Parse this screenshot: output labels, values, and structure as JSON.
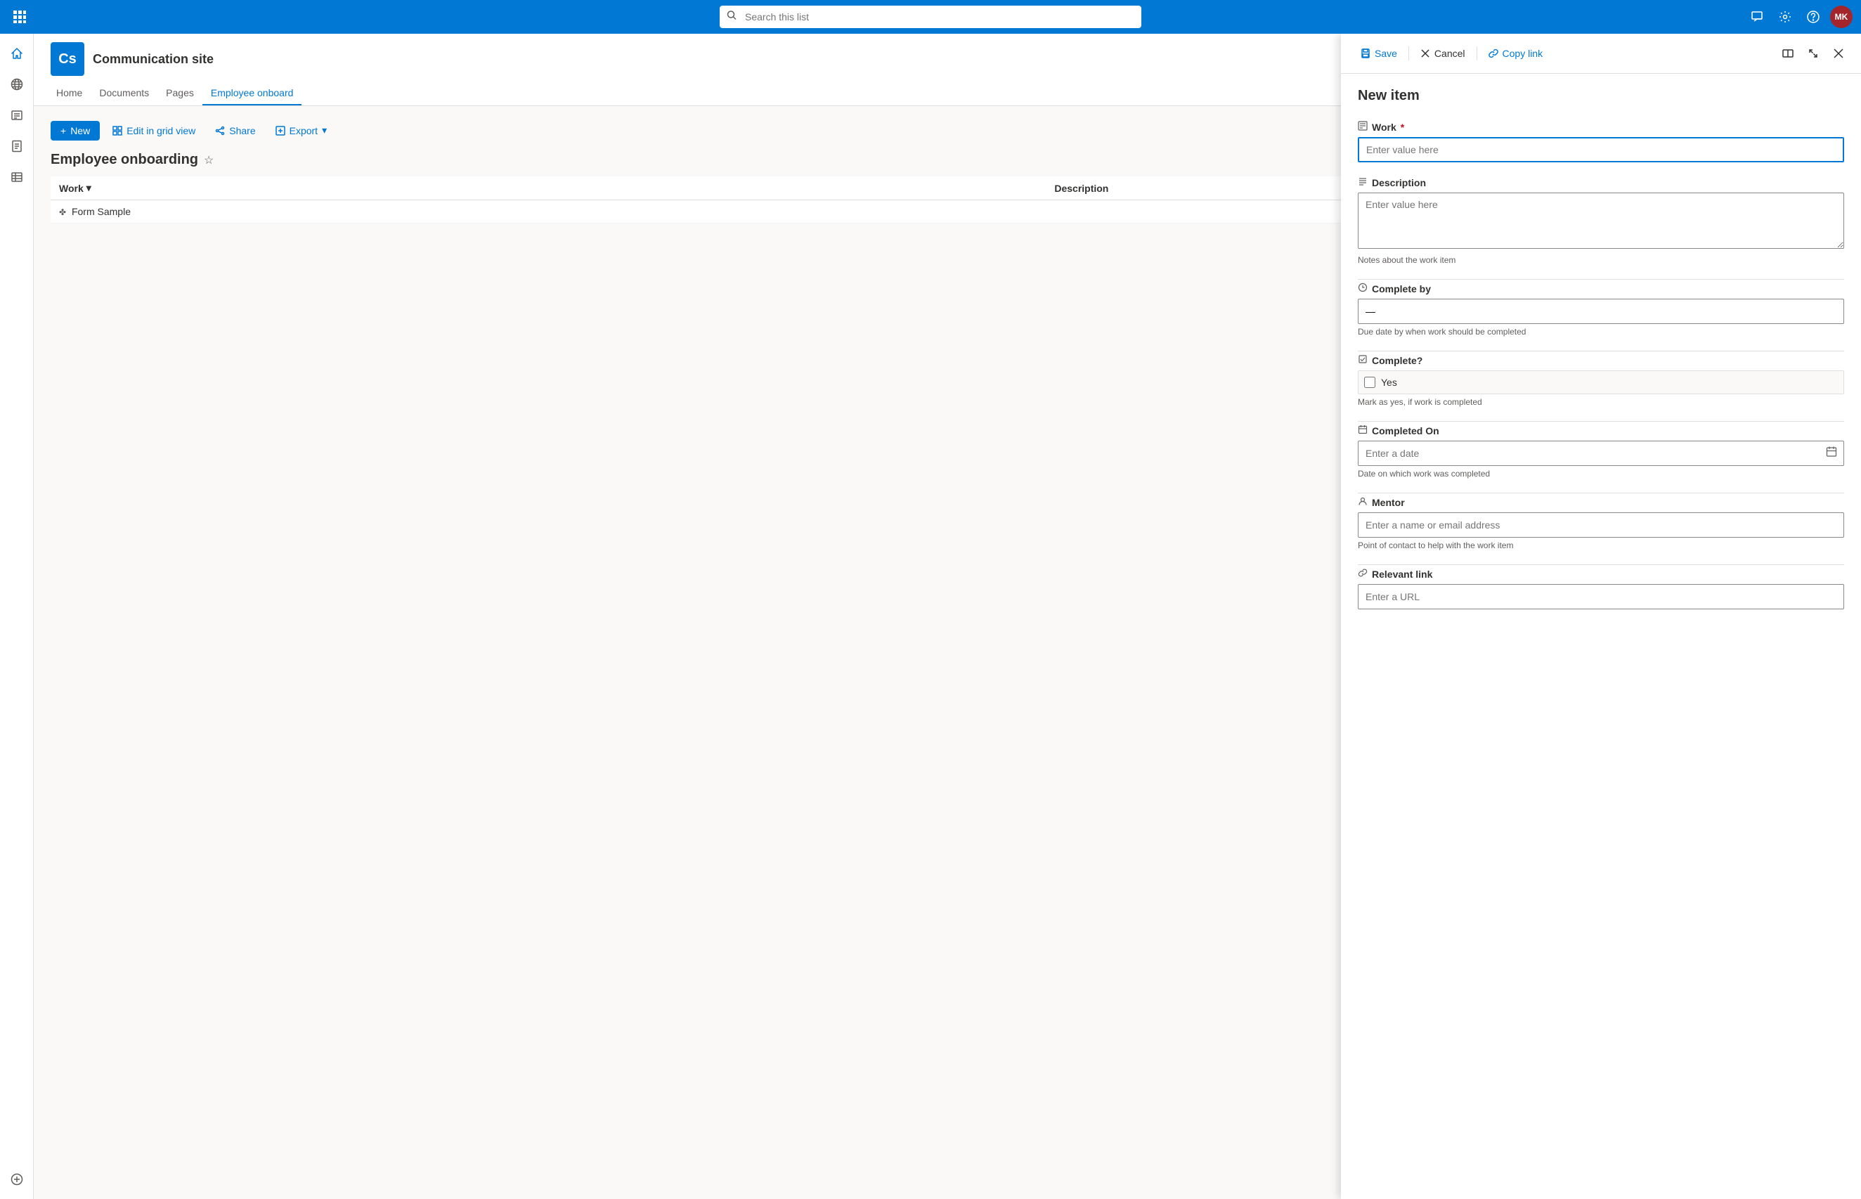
{
  "topbar": {
    "search_placeholder": "Search this list",
    "avatar_initials": "MK"
  },
  "site": {
    "logo_text": "Cs",
    "name": "Communication site",
    "nav": [
      "Home",
      "Documents",
      "Pages",
      "Employee onboard"
    ]
  },
  "toolbar": {
    "new_label": "New",
    "edit_grid_label": "Edit in grid view",
    "share_label": "Share",
    "export_label": "Export"
  },
  "list": {
    "title": "Employee onboarding",
    "columns": [
      {
        "label": "Work"
      },
      {
        "label": "Description"
      }
    ],
    "rows": [
      {
        "work": "Form Sample"
      }
    ]
  },
  "panel": {
    "save_label": "Save",
    "cancel_label": "Cancel",
    "copy_link_label": "Copy link",
    "close_title": "Close",
    "title": "New item",
    "fields": {
      "work": {
        "label": "Work",
        "required": true,
        "placeholder": "Enter value here",
        "icon": "list-icon"
      },
      "description": {
        "label": "Description",
        "placeholder": "Enter value here",
        "hint": "Notes about the work item",
        "icon": "text-icon"
      },
      "complete_by": {
        "label": "Complete by",
        "placeholder": "—",
        "hint": "Due date by when work should be completed",
        "icon": "clock-icon"
      },
      "complete": {
        "label": "Complete?",
        "checkbox_label": "Yes",
        "hint": "Mark as yes, if work is completed",
        "icon": "checkbox-icon"
      },
      "completed_on": {
        "label": "Completed On",
        "placeholder": "Enter a date",
        "hint": "Date on which work was completed",
        "icon": "calendar-icon"
      },
      "mentor": {
        "label": "Mentor",
        "placeholder": "Enter a name or email address",
        "hint": "Point of contact to help with the work item",
        "icon": "person-icon"
      },
      "relevant_link": {
        "label": "Relevant link",
        "placeholder": "Enter a URL",
        "icon": "link-icon"
      }
    }
  },
  "colors": {
    "brand": "#0078d4",
    "required": "#c50f1f",
    "text_primary": "#323130",
    "text_secondary": "#605e5c"
  }
}
